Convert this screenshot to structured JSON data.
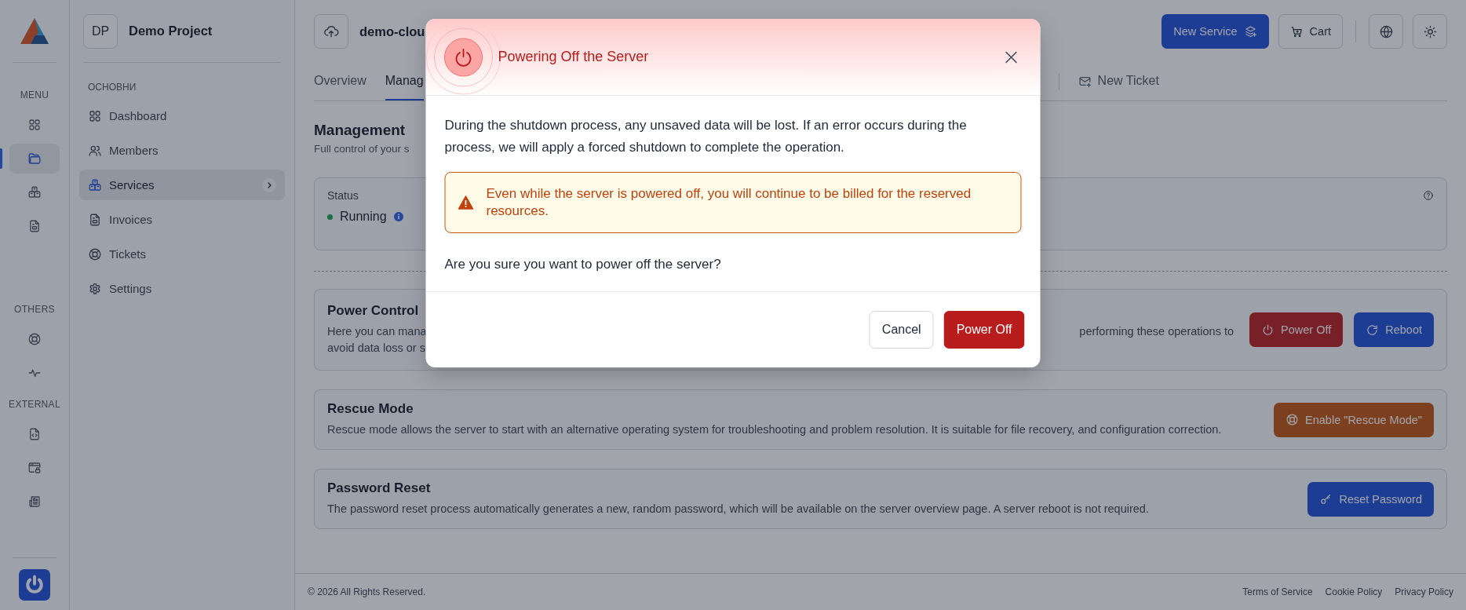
{
  "rail": {
    "sections": [
      {
        "label": "MENU",
        "items": [
          {
            "selected": false
          },
          {
            "selected": true
          },
          {
            "selected": false
          },
          {
            "selected": false
          }
        ]
      },
      {
        "label": "OTHERS",
        "items": [
          {
            "selected": false
          },
          {
            "selected": false
          }
        ]
      },
      {
        "label": "EXTERNAL",
        "items": [
          {
            "selected": false
          },
          {
            "selected": false
          },
          {
            "selected": false
          }
        ]
      }
    ]
  },
  "sidebar": {
    "project": {
      "initials": "DP",
      "name": "Demo Project"
    },
    "group_label": "ОСНОВНИ",
    "items": [
      {
        "label": "Dashboard",
        "selected": false
      },
      {
        "label": "Members",
        "selected": false
      },
      {
        "label": "Services",
        "selected": true
      },
      {
        "label": "Invoices",
        "selected": false
      },
      {
        "label": "Tickets",
        "selected": false
      },
      {
        "label": "Settings",
        "selected": false
      }
    ]
  },
  "header": {
    "title": "demo-clou",
    "buttons": [
      {
        "label": "New Service",
        "kind": "primary"
      },
      {
        "label": "Cart",
        "kind": "outline"
      }
    ]
  },
  "tabs": [
    {
      "label": "Overview",
      "kind": "tab",
      "selected": false
    },
    {
      "label": "Manag",
      "kind": "tab",
      "selected": true
    },
    {
      "label": "New Ticket",
      "kind": "action",
      "selected": false
    }
  ],
  "section": {
    "title": "Management",
    "subtitle": "Full control of your s"
  },
  "status": {
    "label": "Status",
    "value": "Running",
    "online": true
  },
  "cards": [
    {
      "title": "Power Control",
      "description_parts": [
        "Here you can mana",
        "performing these operations to",
        "avoid data loss or s"
      ],
      "buttons": [
        {
          "label": "Power Off",
          "kind": "danger"
        },
        {
          "label": "Reboot",
          "kind": "primary"
        }
      ]
    },
    {
      "title": "Rescue Mode",
      "description": "Rescue mode allows the server to start with an alternative operating system for troubleshooting and problem resolution. It is suitable for file recovery, and configuration correction.",
      "buttons": [
        {
          "label": "Enable \"Rescue Mode\"",
          "kind": "warning"
        }
      ]
    },
    {
      "title": "Password Reset",
      "description": "The password reset process automatically generates a new, random password, which will be available on the server overview page. A server reboot is not required.",
      "buttons": [
        {
          "label": "Reset Password",
          "kind": "primary"
        }
      ]
    }
  ],
  "footer": {
    "copyright": "© 2026 All Rights Reserved.",
    "links": [
      "Terms of Service",
      "Cookie Policy",
      "Privacy Policy"
    ]
  },
  "modal": {
    "title": "Powering Off the Server",
    "message": "During the shutdown process, any unsaved data will be lost. If an error occurs during the process, we will apply a forced shutdown to complete the operation.",
    "alert": "Even while the server is powered off, you will continue to be billed for the reserved resources.",
    "question": "Are you sure you want to power off the server?",
    "buttons": [
      {
        "label": "Cancel",
        "kind": "secondary"
      },
      {
        "label": "Power Off",
        "kind": "danger"
      }
    ]
  }
}
